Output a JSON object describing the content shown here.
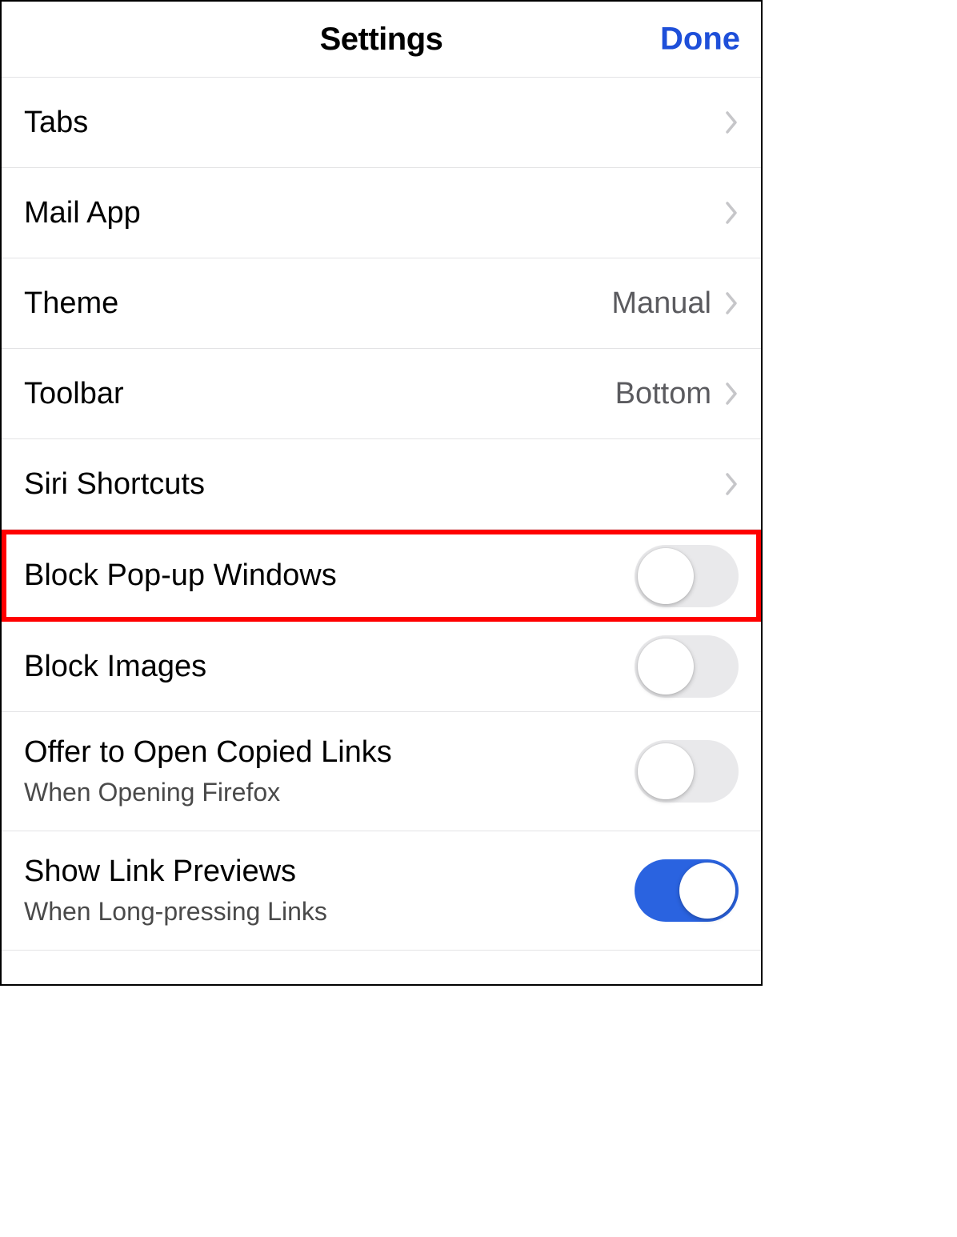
{
  "header": {
    "title": "Settings",
    "done_label": "Done"
  },
  "rows": {
    "tabs": {
      "label": "Tabs"
    },
    "mail_app": {
      "label": "Mail App"
    },
    "theme": {
      "label": "Theme",
      "value": "Manual"
    },
    "toolbar": {
      "label": "Toolbar",
      "value": "Bottom"
    },
    "siri_shortcuts": {
      "label": "Siri Shortcuts"
    },
    "block_popups": {
      "label": "Block Pop-up Windows",
      "toggle": false
    },
    "block_images": {
      "label": "Block Images",
      "toggle": false
    },
    "copied_links": {
      "label": "Offer to Open Copied Links",
      "sublabel": "When Opening Firefox",
      "toggle": false
    },
    "link_previews": {
      "label": "Show Link Previews",
      "sublabel": "When Long-pressing Links",
      "toggle": true
    }
  }
}
